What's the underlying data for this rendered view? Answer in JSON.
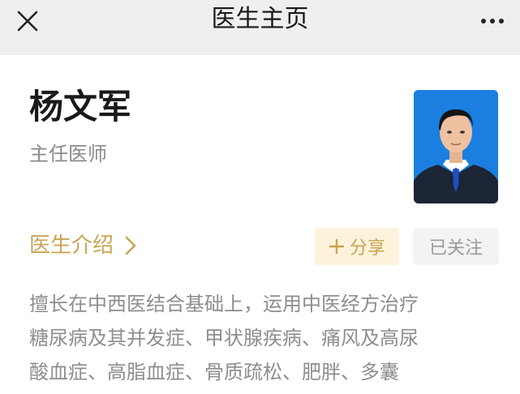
{
  "navbar": {
    "close_icon": "close-icon",
    "title": "医生主页",
    "more_icon": "more-dots-icon"
  },
  "doctor": {
    "name": "杨文军",
    "title": "主任医师",
    "photo": "doctor-portrait"
  },
  "actions": {
    "intro_label": "医生介绍",
    "intro_icon": "chevron-right-icon",
    "share_label": "分享",
    "share_icon": "plus-icon",
    "follow_label": "已关注"
  },
  "bio": {
    "lines": [
      "擅长在中西医结合基础上，运用中医经方治疗",
      "糖尿病及其并发症、甲状腺疾病、痛风及高尿",
      "酸血症、高脂血症、骨质疏松、肥胖、多囊"
    ]
  },
  "colors": {
    "accent": "#c9a455",
    "share_bg": "#fdf3dc",
    "navbar_bg": "#efefef",
    "photo_bg": "#1a7fe0"
  }
}
